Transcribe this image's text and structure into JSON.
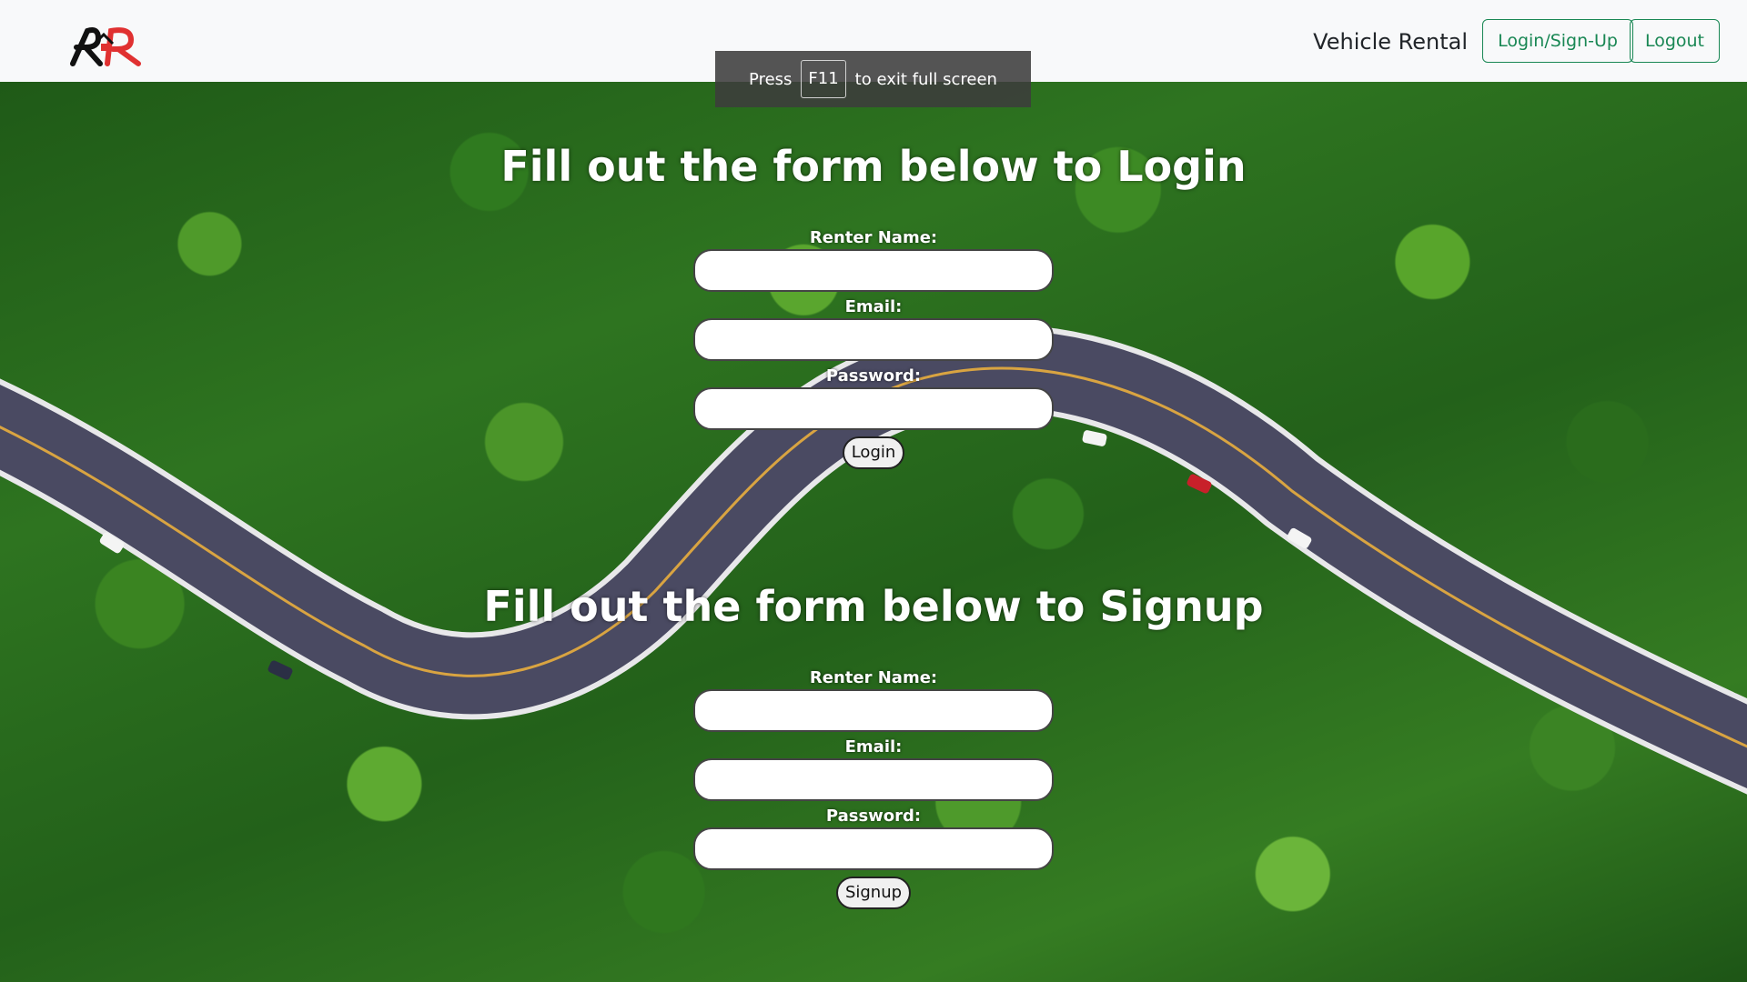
{
  "navbar": {
    "logo_alt": "RR logo",
    "brand": "Vehicle Rental",
    "login_signup_label": "Login/Sign-Up",
    "logout_label": "Logout"
  },
  "fullscreen_hint": {
    "press": "Press",
    "key": "F11",
    "suffix": "to exit full screen"
  },
  "login_form": {
    "title": "Fill out the form below to Login",
    "name_label": "Renter Name:",
    "email_label": "Email:",
    "password_label": "Password:",
    "name_value": "",
    "email_value": "",
    "password_value": "",
    "submit_label": "Login"
  },
  "signup_form": {
    "title": "Fill out the form below to Signup",
    "name_label": "Renter Name:",
    "email_label": "Email:",
    "password_label": "Password:",
    "name_value": "",
    "email_value": "",
    "password_value": "",
    "submit_label": "Signup"
  },
  "colors": {
    "navbar_bg": "#f8f9fa",
    "accent_green": "#198754",
    "logo_red": "#e03131",
    "logo_black": "#111111"
  },
  "icons": {
    "logo": "rr-house-logo"
  }
}
